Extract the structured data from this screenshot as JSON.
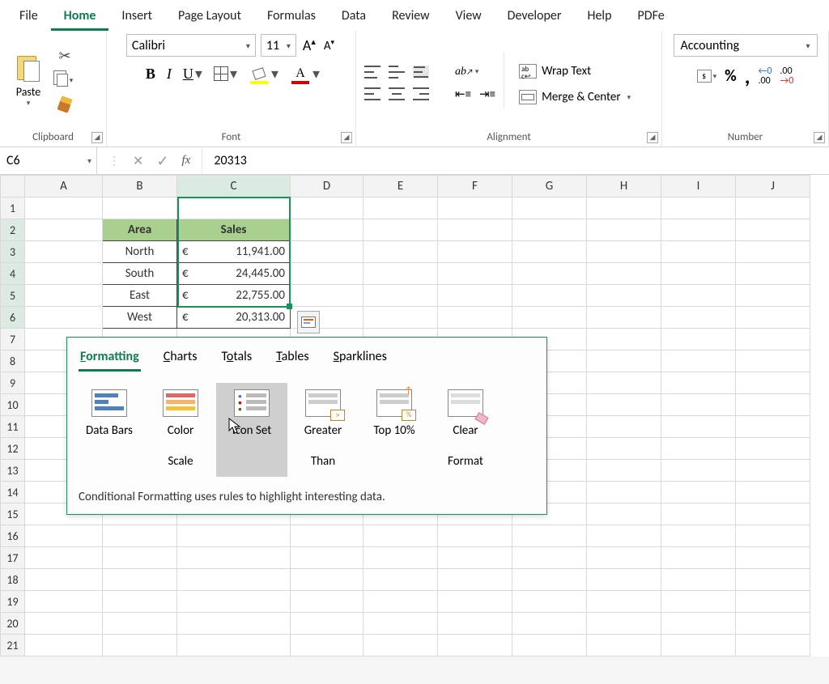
{
  "menubar": {
    "tabs": [
      "File",
      "Home",
      "Insert",
      "Page Layout",
      "Formulas",
      "Data",
      "Review",
      "View",
      "Developer",
      "Help",
      "PDFe"
    ],
    "active": "Home"
  },
  "ribbon": {
    "clipboard": {
      "paste": "Paste",
      "label": "Clipboard"
    },
    "font": {
      "name": "Calibri",
      "size": "11",
      "label": "Font"
    },
    "alignment": {
      "wrap": "Wrap Text",
      "merge": "Merge & Center",
      "label": "Alignment"
    },
    "number": {
      "format": "Accounting",
      "label": "Number"
    }
  },
  "formula_bar": {
    "name_box": "C6",
    "fx": "fx",
    "value": "20313"
  },
  "grid": {
    "columns": [
      "A",
      "B",
      "C",
      "D",
      "E",
      "F",
      "G",
      "H",
      "I",
      "J"
    ],
    "rows": 21,
    "table": {
      "headers": {
        "area": "Area",
        "sales": "Sales"
      },
      "currency": "€",
      "data": [
        {
          "area": "North",
          "sales": "11,941.00"
        },
        {
          "area": "South",
          "sales": "24,445.00"
        },
        {
          "area": "East",
          "sales": "22,755.00"
        },
        {
          "area": "West",
          "sales": "20,313.00"
        }
      ]
    }
  },
  "quick_analysis": {
    "tabs": [
      {
        "pre": "",
        "ul": "F",
        "post": "ormatting",
        "active": true
      },
      {
        "pre": "",
        "ul": "C",
        "post": "harts",
        "active": false
      },
      {
        "pre": "T",
        "ul": "o",
        "post": "tals",
        "active": false
      },
      {
        "pre": "",
        "ul": "T",
        "post": "ables",
        "active": false
      },
      {
        "pre": "",
        "ul": "S",
        "post": "parklines",
        "active": false
      }
    ],
    "items": [
      {
        "label_top": "Data Bars",
        "label_bot": ""
      },
      {
        "label_top": "Color",
        "label_bot": "Scale"
      },
      {
        "label_top": "Icon Set",
        "label_bot": ""
      },
      {
        "label_top": "Greater",
        "label_bot": "Than"
      },
      {
        "label_top": "Top 10%",
        "label_bot": ""
      },
      {
        "label_top": "Clear",
        "label_bot": "Format"
      }
    ],
    "description": "Conditional Formatting uses rules to highlight interesting data."
  }
}
